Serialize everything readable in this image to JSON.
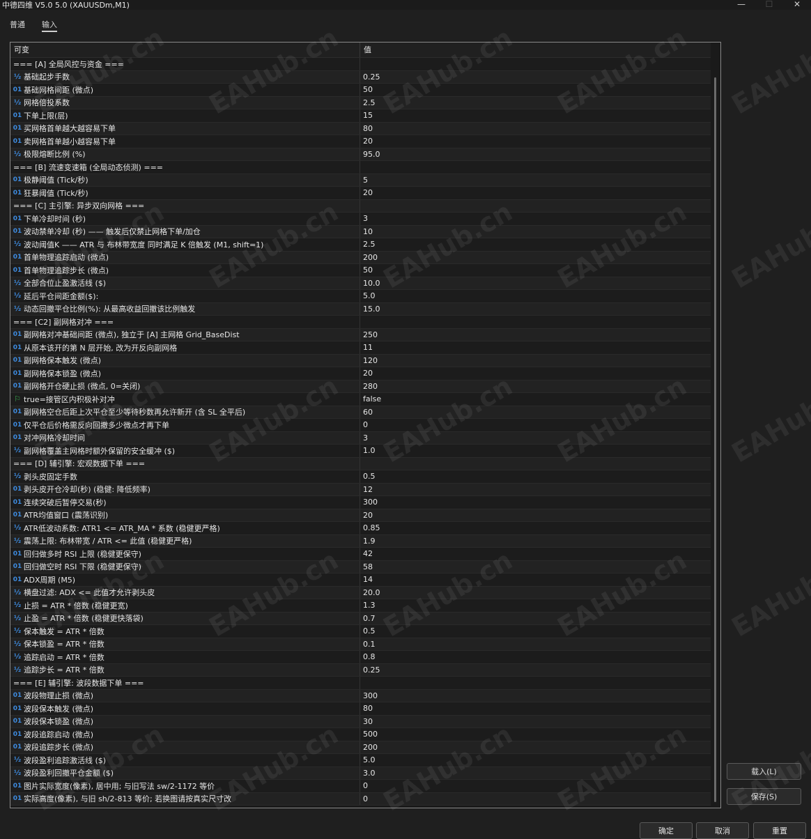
{
  "window": {
    "title": "中德四维 V5.0 5.0 (XAUUSDm,M1)",
    "minimize_glyph": "—",
    "maximize_glyph": "☐",
    "close_glyph": "✕"
  },
  "tabs": [
    {
      "label": "普通"
    },
    {
      "label": "输入"
    }
  ],
  "grid": {
    "header_name": "可变",
    "header_value": "值"
  },
  "params": [
    {
      "name": "=== [A] 全局风控与资金 ===",
      "value": "",
      "type": "section"
    },
    {
      "name": "基础起步手数",
      "value": "0.25",
      "type": "double"
    },
    {
      "name": "基础网格间距 (微点)",
      "value": "50",
      "type": "int"
    },
    {
      "name": "网格倍投系数",
      "value": "2.5",
      "type": "double"
    },
    {
      "name": "下单上限(层)",
      "value": "15",
      "type": "int"
    },
    {
      "name": "买网格首单越大越容易下单",
      "value": "80",
      "type": "int"
    },
    {
      "name": "卖网格首单越小越容易下单",
      "value": "20",
      "type": "int"
    },
    {
      "name": "极限熔断比例 (%)",
      "value": "95.0",
      "type": "double"
    },
    {
      "name": "=== [B] 流速变速箱 (全局动态侦测) ===",
      "value": "",
      "type": "section"
    },
    {
      "name": "极静阈值 (Tick/秒)",
      "value": "5",
      "type": "int"
    },
    {
      "name": "狂暴阈值 (Tick/秒)",
      "value": "20",
      "type": "int"
    },
    {
      "name": "=== [C] 主引擎: 异步双向网格 ===",
      "value": "",
      "type": "section"
    },
    {
      "name": "下单冷却时间 (秒)",
      "value": "3",
      "type": "int"
    },
    {
      "name": "波动禁单冷却 (秒) —— 触发后仅禁止网格下单/加仓",
      "value": "10",
      "type": "int"
    },
    {
      "name": "波动阈值K —— ATR 与 布林带宽度 同时满足 K 倍触发 (M1, shift=1)",
      "value": "2.5",
      "type": "double"
    },
    {
      "name": "首单物理追踪启动 (微点)",
      "value": "200",
      "type": "int"
    },
    {
      "name": "首单物理追踪步长 (微点)",
      "value": "50",
      "type": "int"
    },
    {
      "name": "全部合位止盈激活线 ($)",
      "value": "10.0",
      "type": "double"
    },
    {
      "name": "延后平仓间距金额($):",
      "value": "5.0",
      "type": "double"
    },
    {
      "name": "动态回撤平仓比例(%): 从最高收益回撤该比例触发",
      "value": "15.0",
      "type": "double"
    },
    {
      "name": "=== [C2] 副网格对冲 ===",
      "value": "",
      "type": "section"
    },
    {
      "name": "副网格对冲基础间距 (微点), 独立于 [A] 主网格 Grid_BaseDist",
      "value": "250",
      "type": "int"
    },
    {
      "name": "从原本该开的第 N 层开始, 改为开反向副网格",
      "value": "11",
      "type": "int"
    },
    {
      "name": "副网格保本触发 (微点)",
      "value": "120",
      "type": "int"
    },
    {
      "name": "副网格保本锁盈 (微点)",
      "value": "20",
      "type": "int"
    },
    {
      "name": "副网格开仓硬止损 (微点, 0=关闭)",
      "value": "280",
      "type": "int"
    },
    {
      "name": "true=接管区内积极补对冲",
      "value": "false",
      "type": "bool"
    },
    {
      "name": "副网格空仓后距上次平仓至少等待秒数再允许新开 (含 SL 全平后)",
      "value": "60",
      "type": "int"
    },
    {
      "name": "仅平仓后价格需反向回撤多少微点才再下单",
      "value": "0",
      "type": "int"
    },
    {
      "name": "对冲网格冷却时间",
      "value": "3",
      "type": "int"
    },
    {
      "name": "副网格覆盖主网格时额外保留的安全缓冲 ($)",
      "value": "1.0",
      "type": "double"
    },
    {
      "name": "=== [D] 辅引擎: 宏观数据下单 ===",
      "value": "",
      "type": "section"
    },
    {
      "name": "剥头皮固定手数",
      "value": "0.5",
      "type": "double"
    },
    {
      "name": "剥头皮开仓冷却(秒) (稳健: 降低频率)",
      "value": "12",
      "type": "int"
    },
    {
      "name": "连续突破后暂停交易(秒)",
      "value": "300",
      "type": "int"
    },
    {
      "name": "ATR均值窗口 (震荡识别)",
      "value": "20",
      "type": "int"
    },
    {
      "name": "ATR低波动系数: ATR1 <= ATR_MA * 系数 (稳健更严格)",
      "value": "0.85",
      "type": "double"
    },
    {
      "name": "震荡上限: 布林带宽 / ATR <= 此值 (稳健更严格)",
      "value": "1.9",
      "type": "double"
    },
    {
      "name": "回归做多时 RSI 上限 (稳健更保守)",
      "value": "42",
      "type": "int"
    },
    {
      "name": "回归做空时 RSI 下限 (稳健更保守)",
      "value": "58",
      "type": "int"
    },
    {
      "name": "ADX周期 (M5)",
      "value": "14",
      "type": "int"
    },
    {
      "name": "横盘过滤: ADX <= 此值才允许剥头皮",
      "value": "20.0",
      "type": "double"
    },
    {
      "name": "止损 = ATR * 倍数 (稳健更宽)",
      "value": "1.3",
      "type": "double"
    },
    {
      "name": "止盈 = ATR * 倍数 (稳健更快落袋)",
      "value": "0.7",
      "type": "double"
    },
    {
      "name": "保本触发 = ATR * 倍数",
      "value": "0.5",
      "type": "double"
    },
    {
      "name": "保本锁盈 = ATR * 倍数",
      "value": "0.1",
      "type": "double"
    },
    {
      "name": "追踪启动 = ATR * 倍数",
      "value": "0.8",
      "type": "double"
    },
    {
      "name": "追踪步长 = ATR * 倍数",
      "value": "0.25",
      "type": "double"
    },
    {
      "name": "=== [E] 辅引擎: 波段数据下单 ===",
      "value": "",
      "type": "section"
    },
    {
      "name": "波段物理止损 (微点)",
      "value": "300",
      "type": "int"
    },
    {
      "name": "波段保本触发 (微点)",
      "value": "80",
      "type": "int"
    },
    {
      "name": "波段保本锁盈 (微点)",
      "value": "30",
      "type": "int"
    },
    {
      "name": "波段追踪启动 (微点)",
      "value": "500",
      "type": "int"
    },
    {
      "name": "波段追踪步长 (微点)",
      "value": "200",
      "type": "int"
    },
    {
      "name": "波段盈利追踪激活线 ($)",
      "value": "5.0",
      "type": "double"
    },
    {
      "name": "波段盈利回撤平仓金额 ($)",
      "value": "3.0",
      "type": "double"
    },
    {
      "name": "图片实际宽度(像素), 居中用; 与旧写法 sw/2-1172 等价",
      "value": "0",
      "type": "int"
    },
    {
      "name": "实际高度(像素), 与旧 sh/2-813 等价; 若换图请按真实尺寸改",
      "value": "0",
      "type": "int"
    }
  ],
  "icons": {
    "int": "01",
    "double": "½",
    "bool": "⚐",
    "int_name": "integer-type-icon",
    "double_name": "double-type-icon",
    "bool_name": "boolean-type-icon"
  },
  "buttons": {
    "load": "载入(L)",
    "save": "保存(S)",
    "ok": "确定",
    "cancel": "取消",
    "reset": "重置"
  },
  "watermark": "EAHub.cn",
  "colors": {
    "background": "#1f1f1f",
    "int_icon": "#3d8be0",
    "bool_icon": "#3cba54"
  }
}
